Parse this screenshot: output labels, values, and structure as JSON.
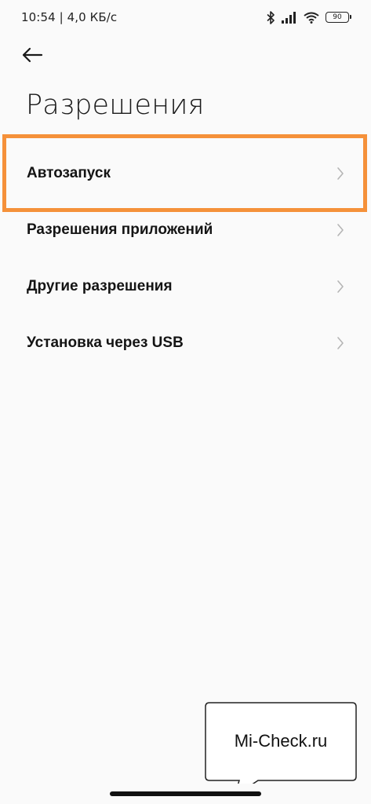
{
  "status_bar": {
    "time_speed": "10:54 | 4,0 КБ/с",
    "battery_level": "90",
    "icons": [
      "bluetooth-icon",
      "signal-icon",
      "wifi-icon",
      "battery-icon"
    ]
  },
  "header": {
    "back_icon": "arrow-left-icon",
    "title": "Разрешения"
  },
  "menu": {
    "items": [
      {
        "label": "Автозапуск",
        "icon": "chevron-right-icon",
        "highlighted": true
      },
      {
        "label": "Разрешения приложений",
        "icon": "chevron-right-icon"
      },
      {
        "label": "Другие разрешения",
        "icon": "chevron-right-icon"
      },
      {
        "label": "Установка через USB",
        "icon": "chevron-right-icon"
      }
    ]
  },
  "colors": {
    "highlight": "#f5913a",
    "background": "#fafafa"
  },
  "watermark": {
    "text": "Mi-Check.ru"
  }
}
